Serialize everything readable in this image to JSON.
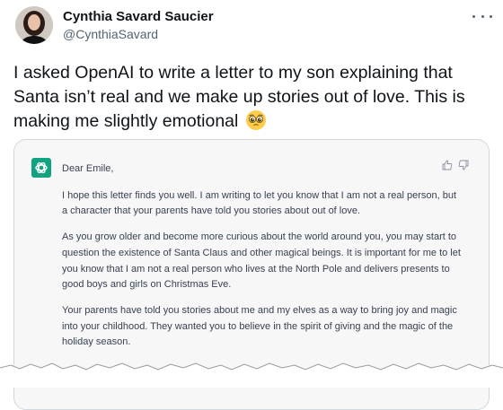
{
  "author": {
    "name": "Cynthia Savard Saucier",
    "handle": "@CynthiaSavard"
  },
  "tweet": {
    "text": "I asked OpenAI to write a letter to my son explaining that Santa isn’t real and we make up stories out of love. This is making me slightly emotional",
    "emoji": "pleading-face-emoji"
  },
  "icons": {
    "more": "more-horizontal-icon",
    "assistant": "openai-logo-icon",
    "thumbs_up": "thumbs-up-icon",
    "thumbs_down": "thumbs-down-icon"
  },
  "colors": {
    "openai_green": "#10a37f",
    "card_bg": "#f7f7f8",
    "handle_gray": "#536471"
  },
  "letter": {
    "greeting": "Dear Emile,",
    "p1": "I hope this letter finds you well. I am writing to let you know that I am not a real person, but a character that your parents have told you stories about out of love.",
    "p2": "As you grow older and become more curious about the world around you, you may start to question the existence of Santa Claus and other magical beings. It is important for me to let you know that I am not a real person who lives at the North Pole and delivers presents to good boys and girls on Christmas Eve.",
    "p3": "Your parents have told you stories about me and my elves as a way to bring joy and magic into your childhood. They wanted you to believe in the spirit of giving and the magic of the holiday season."
  }
}
